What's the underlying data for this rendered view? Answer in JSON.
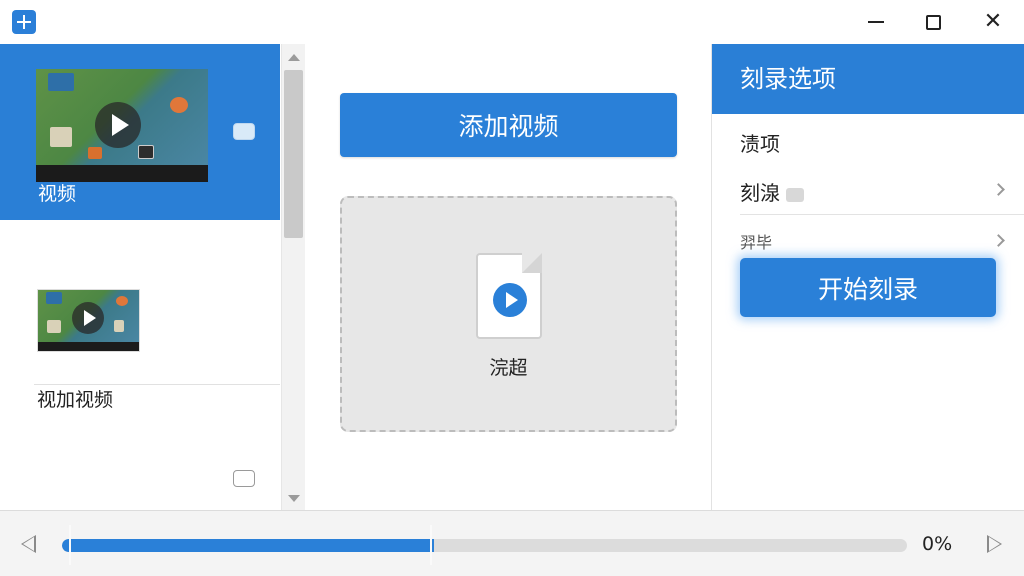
{
  "window": {
    "controls": [
      "minimize",
      "maximize",
      "close"
    ],
    "close_glyph": "✕"
  },
  "video_list": {
    "items": [
      {
        "label": "视频",
        "selected": true,
        "checked": true
      },
      {
        "label": "视加视频",
        "selected": false,
        "checked": false
      }
    ]
  },
  "main": {
    "add_video_label": "添加视频",
    "drop_zone_label": "浣超"
  },
  "burn_options": {
    "header": "刻录选项",
    "rows": [
      {
        "label": "渍项"
      },
      {
        "label": "刻湶"
      },
      {
        "label": "羿毕"
      }
    ],
    "start_button_label": "开始刻录"
  },
  "progress": {
    "percent_label": "0%",
    "played_fraction": 0.44
  },
  "colors": {
    "accent": "#2a80d8",
    "selected_row": "#2a7fd6",
    "drop_zone_bg": "#e7e7e7"
  },
  "icons": [
    "app-icon",
    "minimize-icon",
    "maximize-icon",
    "close-icon",
    "play-icon",
    "video-file-icon",
    "chevron-right-icon",
    "prev-icon",
    "next-icon"
  ]
}
